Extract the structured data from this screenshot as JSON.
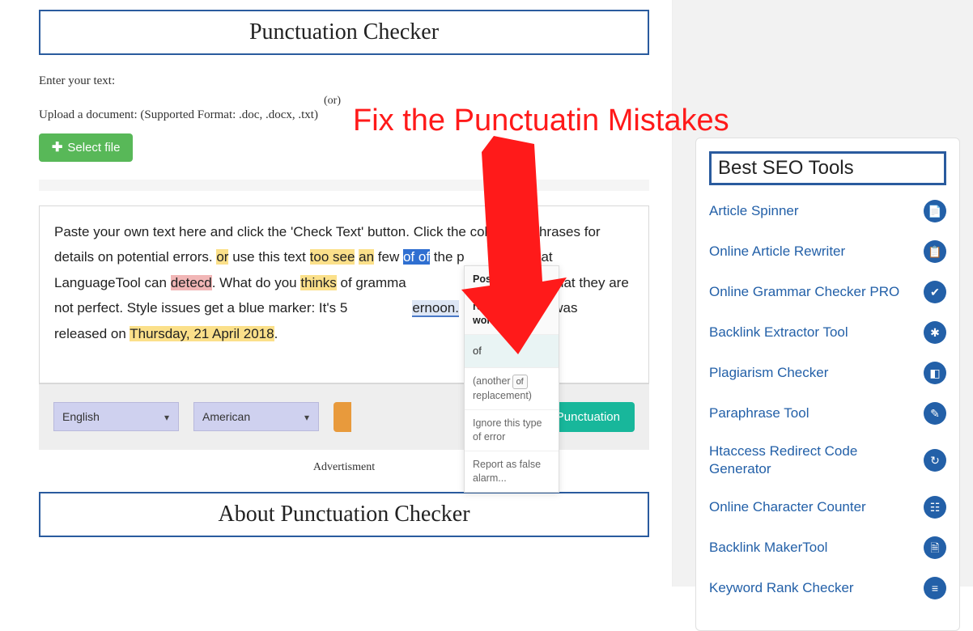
{
  "main": {
    "title": "Punctuation Checker",
    "enter_text_label": "Enter your text:",
    "or_label": "(or)",
    "upload_label": "Upload a document: (Supported Format: .doc, .docx, .txt)",
    "select_file_btn": "Select file",
    "editor": {
      "intro_a": "Paste your own text here and click the 'Check Text' button. Click the colo",
      "intro_b": " phrases for details on potential errors. ",
      "tok_or": "or",
      "mid1": " use this text ",
      "tok_toosee": "too see",
      "mid2": " ",
      "tok_an": "an",
      "mid3": " few ",
      "tok_ofof": "of of",
      "mid4": " the ",
      "gap1": "p",
      "gap2": "ns that LanguageTool can ",
      "tok_detecd": "detecd",
      "mid5": ". What do you ",
      "tok_thinks": "thinks",
      "mid6": " of gramma",
      "gap3": "ase ",
      "tok_not": "not",
      "mid7": " that they are not perfect. Style issues get a blue marker: It's 5",
      "tok_afternoon": "ernoon.",
      "mid8": " LanguageTool was released on ",
      "tok_date": "Thursday, 21 April 2018",
      "mid9": "."
    },
    "tooltip": {
      "head_a": "Possible",
      "head_b": "typo: y",
      "head_c": "repeat",
      "head_d": "word.",
      "suggestion": "of",
      "another_a": "(another",
      "another_badge": "of",
      "another_b": "replacement)",
      "ignore": "Ignore this type of error",
      "report": "Report as false alarm..."
    },
    "lang_sel": "English",
    "variant_sel": "American",
    "check_btn": "Check Punctuation",
    "advert_label": "Advertisment",
    "about_title": "About Punctuation Checker"
  },
  "annotation_text": "Fix the Punctuatin Mistakes",
  "sidebar": {
    "title": "Best SEO Tools",
    "items": [
      {
        "label": "Article Spinner",
        "icon": "📄"
      },
      {
        "label": "Online Article Rewriter",
        "icon": "📋"
      },
      {
        "label": "Online Grammar Checker PRO",
        "icon": "✔"
      },
      {
        "label": "Backlink Extractor Tool",
        "icon": "✱"
      },
      {
        "label": "Plagiarism Checker",
        "icon": "◧"
      },
      {
        "label": "Paraphrase Tool",
        "icon": "✎"
      },
      {
        "label": "Htaccess Redirect Code Generator",
        "icon": "↻"
      },
      {
        "label": "Online Character Counter",
        "icon": "☷"
      },
      {
        "label": "Backlink MakerTool",
        "icon": "🗎"
      },
      {
        "label": "Keyword Rank Checker",
        "icon": "≡"
      }
    ]
  }
}
